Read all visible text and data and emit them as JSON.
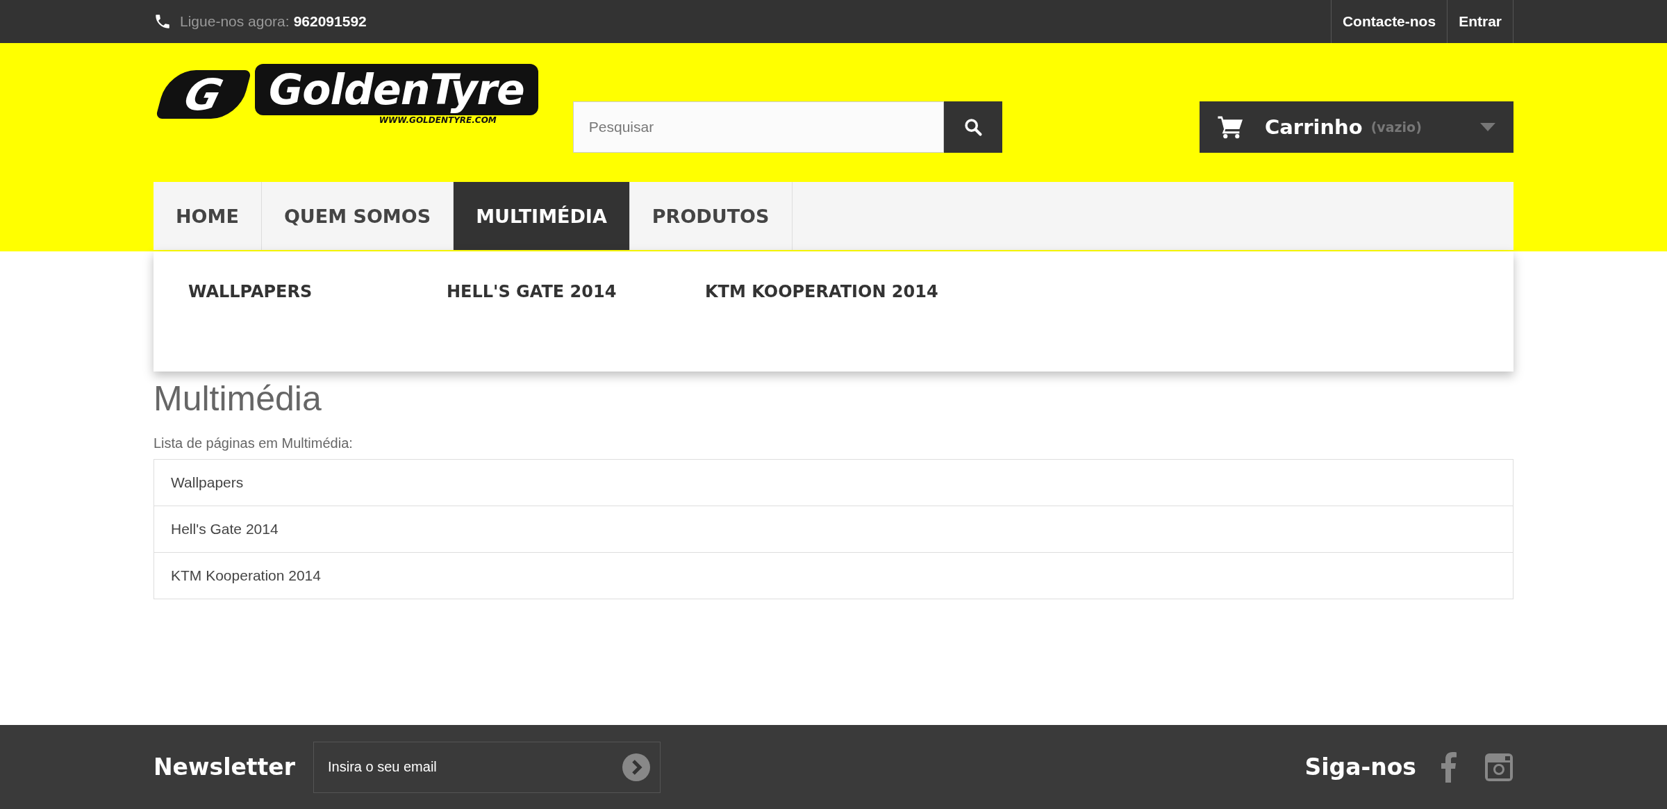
{
  "topbar": {
    "call_label": "Ligue-nos agora:",
    "phone": "962091592",
    "links": [
      "Contacte-nos",
      "Entrar"
    ]
  },
  "logo": {
    "letter": "G",
    "name": "GoldenTyre",
    "url": "WWW.GOLDENTYRE.COM"
  },
  "search": {
    "placeholder": "Pesquisar"
  },
  "cart": {
    "label": "Carrinho",
    "status": "(vazio)"
  },
  "nav": [
    {
      "label": "HOME",
      "selected": false
    },
    {
      "label": "QUEM SOMOS",
      "selected": false
    },
    {
      "label": "MULTIMÉDIA",
      "selected": true
    },
    {
      "label": "PRODUTOS",
      "selected": false
    }
  ],
  "dropdown": [
    "WALLPAPERS",
    "HELL'S GATE 2014",
    "KTM KOOPERATION 2014"
  ],
  "page": {
    "title": "Multimédia",
    "intro": "Lista de páginas em Multimédia:",
    "pages": [
      "Wallpapers",
      "Hell's Gate 2014",
      "KTM Kooperation 2014"
    ]
  },
  "footer": {
    "newsletter": "Newsletter",
    "email_placeholder": "Insira o seu email",
    "follow": "Siga-nos"
  }
}
